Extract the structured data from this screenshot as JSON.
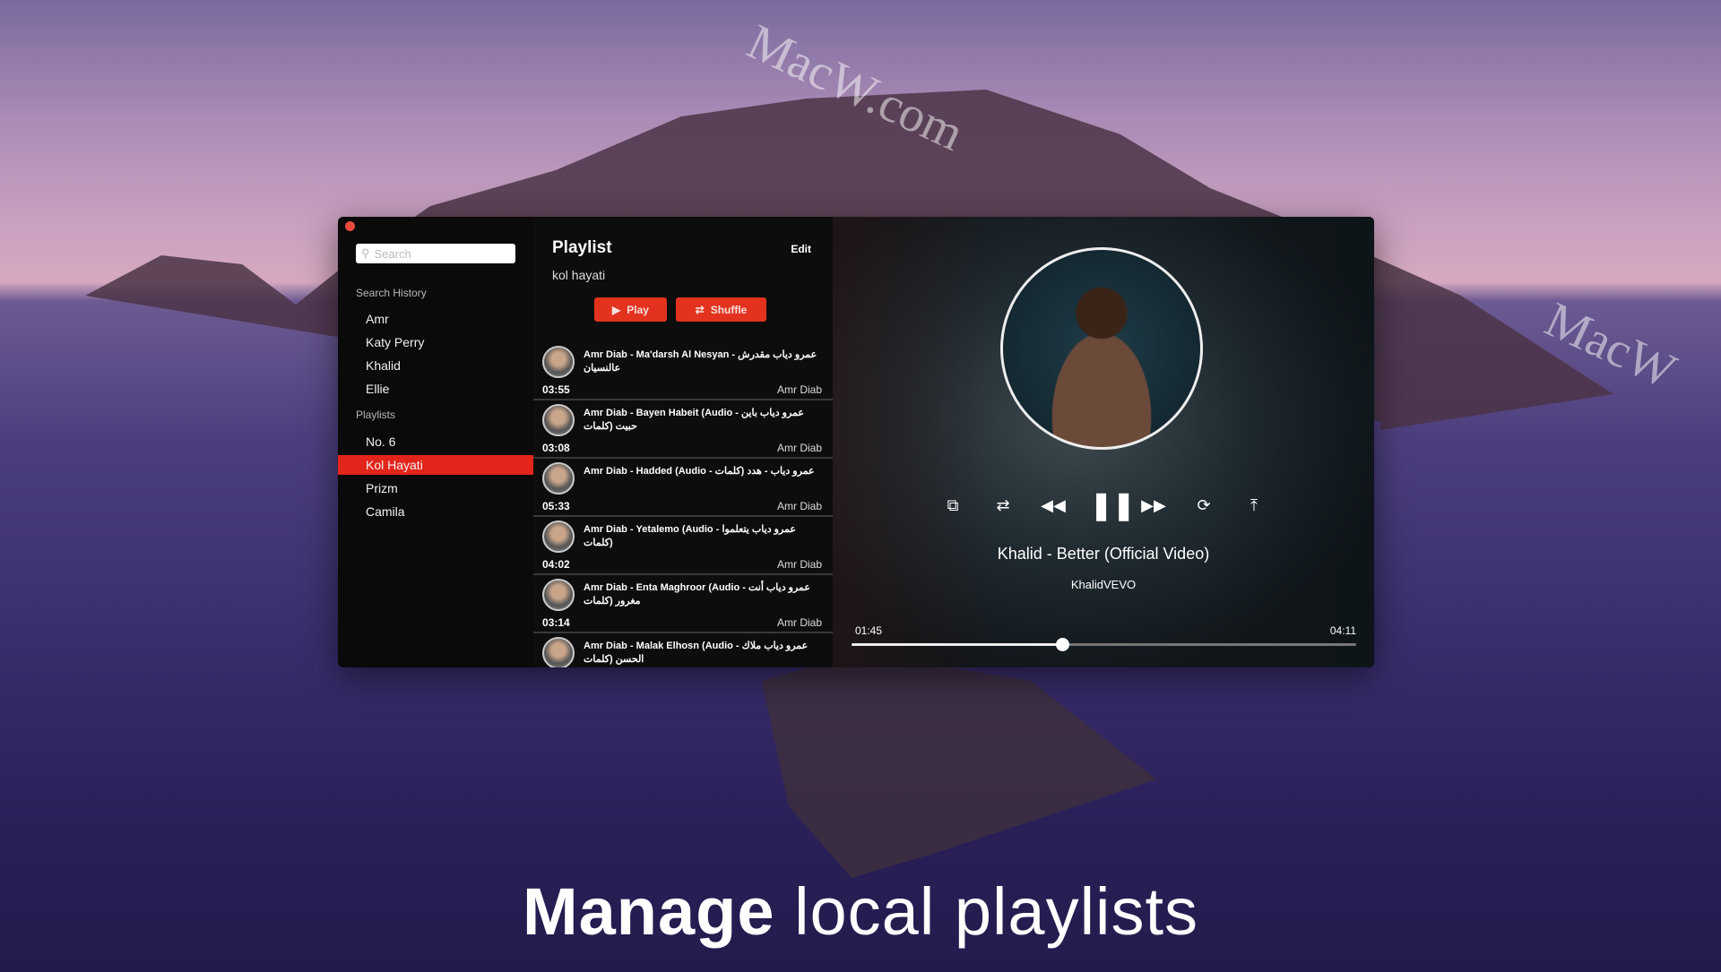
{
  "sidebar": {
    "search_placeholder": "Search",
    "search_history_label": "Search History",
    "history": [
      "Amr",
      "Katy Perry",
      "Khalid",
      "Ellie"
    ],
    "playlists_label": "Playlists",
    "playlists": [
      "No. 6",
      "Kol Hayati",
      "Prizm",
      "Camila"
    ],
    "selected_playlist": "Kol Hayati"
  },
  "playlist": {
    "title": "Playlist",
    "edit": "Edit",
    "name": "kol hayati",
    "play": "Play",
    "shuffle": "Shuffle",
    "tracks": [
      {
        "title": "Amr Diab - Ma'darsh Al Nesyan - عمرو دياب مقدرش عالنسيان",
        "duration": "03:55",
        "artist": "Amr Diab"
      },
      {
        "title": "Amr Diab - Bayen Habeit (Audio - عمرو دياب باين حبيت (كلمات",
        "duration": "03:08",
        "artist": "Amr Diab"
      },
      {
        "title": "Amr Diab - Hadded (Audio - عمرو دياب - هدد (كلمات",
        "duration": "05:33",
        "artist": "Amr Diab"
      },
      {
        "title": "Amr Diab - Yetalemo (Audio - عمرو دياب يتعلموا (كلمات",
        "duration": "04:02",
        "artist": "Amr Diab"
      },
      {
        "title": "Amr Diab - Enta Maghroor (Audio - عمرو دياب أنت مغرور (كلمات",
        "duration": "03:14",
        "artist": "Amr Diab"
      },
      {
        "title": "Amr Diab - Malak Elhosn (Audio - عمرو دياب ملاك الحسن (كلمات",
        "duration": "",
        "artist": ""
      }
    ]
  },
  "player": {
    "title": "Khalid - Better (Official Video)",
    "artist": "KhalidVEVO",
    "elapsed": "01:45",
    "total": "04:11",
    "progress": 0.418,
    "state": "playing"
  },
  "caption": {
    "bold": "Manage",
    "light": "local playlists"
  },
  "watermark": "MacW.com",
  "colors": {
    "accent": "#e3241a"
  }
}
